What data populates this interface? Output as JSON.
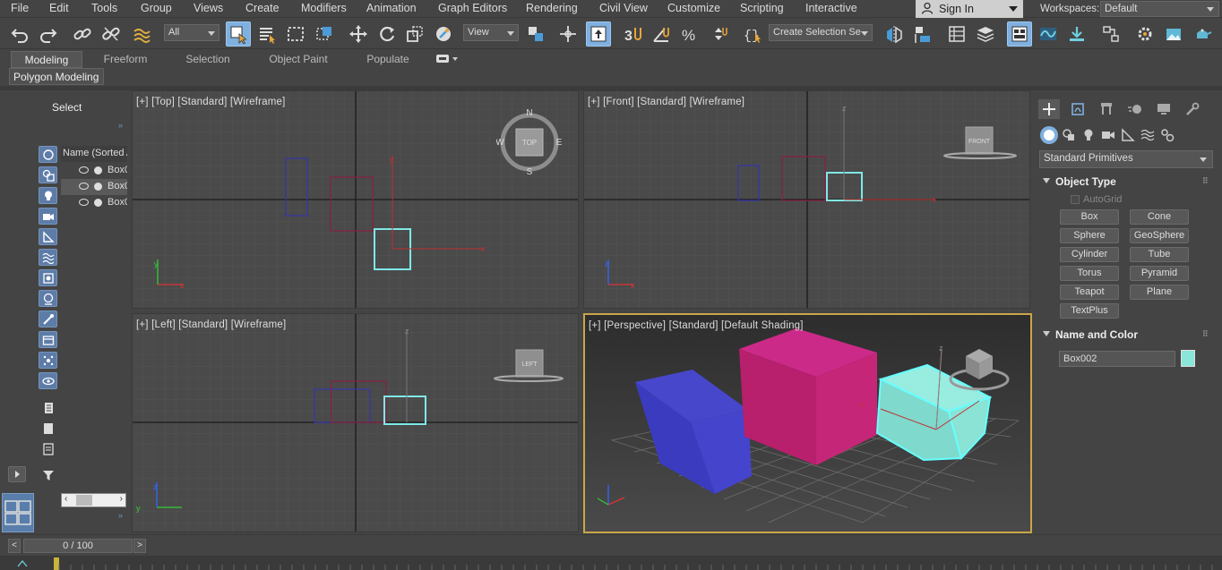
{
  "menubar": {
    "items": [
      "File",
      "Edit",
      "Tools",
      "Group",
      "Views",
      "Create",
      "Modifiers",
      "Animation",
      "Graph Editors",
      "Rendering",
      "Civil View",
      "Customize",
      "Scripting",
      "Interactive"
    ],
    "sign_in": "Sign In",
    "workspaces_label": "Workspaces:",
    "workspace_value": "Default"
  },
  "toolbar": {
    "filter_value": "All",
    "ref_coord_value": "View",
    "selection_set_value": "Create Selection Se"
  },
  "ribbon": {
    "tabs": [
      "Modeling",
      "Freeform",
      "Selection",
      "Object Paint",
      "Populate"
    ],
    "active_tab": "Modeling",
    "sub_tab": "Polygon Modeling"
  },
  "scene_explorer": {
    "select_label": "Select",
    "column_header": "Name (Sorted A",
    "rows": [
      "Box0",
      "Box0",
      "Box0"
    ]
  },
  "viewports": {
    "top": "[+] [Top] [Standard] [Wireframe]",
    "front": "[+] [Front] [Standard] [Wireframe]",
    "left": "[+] [Left] [Standard] [Wireframe]",
    "perspective": "[+] [Perspective] [Standard] [Default Shading]",
    "compass": {
      "n": "N",
      "s": "S",
      "e": "E",
      "w": "W"
    },
    "viewcube": {
      "top": "TOP",
      "front": "FRONT",
      "left": "LEFT"
    }
  },
  "command_panel": {
    "dropdown": "Standard Primitives",
    "object_type_title": "Object Type",
    "autogrid": "AutoGrid",
    "buttons": [
      "Box",
      "Cone",
      "Sphere",
      "GeoSphere",
      "Cylinder",
      "Tube",
      "Torus",
      "Pyramid",
      "Teapot",
      "Plane",
      "TextPlus"
    ],
    "name_color_title": "Name and Color",
    "name_value": "Box002",
    "color": "#8ae6d8"
  },
  "timeline": {
    "frame": "0 / 100",
    "prev": "<",
    "next": ">"
  },
  "colors": {
    "blue_box": "#3a3ad0",
    "magenta_box": "#c81e78",
    "cyan_box": "#8ae6d8",
    "selection_highlight": "#7fb0e0"
  }
}
